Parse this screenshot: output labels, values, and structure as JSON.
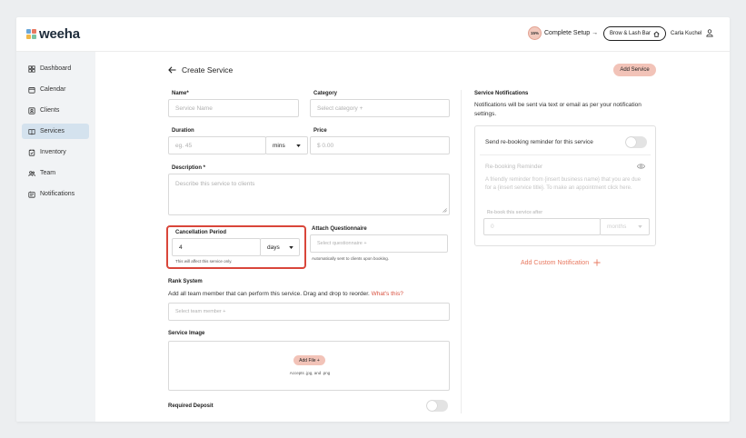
{
  "brand": {
    "name": "weeha",
    "mark_colors": [
      "#6aa7d8",
      "#e8785f",
      "#f0b84a",
      "#7cc4a2"
    ],
    "accent": "#f2c3b8",
    "highlight_border": "#d9463a",
    "link_color": "#d8503f"
  },
  "topbar": {
    "setup_percent": "15%",
    "setup_label": "Complete Setup →",
    "business_name": "Brow & Lash Bar",
    "user_name": "Carla Kuchel"
  },
  "sidebar": {
    "items": [
      {
        "label": "Dashboard",
        "icon": "dashboard-icon"
      },
      {
        "label": "Calendar",
        "icon": "calendar-icon"
      },
      {
        "label": "Clients",
        "icon": "clients-icon"
      },
      {
        "label": "Services",
        "icon": "services-icon",
        "active": true
      },
      {
        "label": "Inventory",
        "icon": "inventory-icon"
      },
      {
        "label": "Team",
        "icon": "team-icon"
      },
      {
        "label": "Notifications",
        "icon": "notifications-icon"
      }
    ]
  },
  "form": {
    "title": "Create Service",
    "add_button": "Add Service",
    "name_label": "Name",
    "name_placeholder": "Service Name",
    "category_label": "Category",
    "category_placeholder": "Select category +",
    "duration_label": "Duration",
    "duration_placeholder": "eg. 45",
    "duration_unit": "mins",
    "price_label": "Price",
    "price_placeholder": "$ 0.00",
    "description_label": "Description *",
    "description_placeholder": "Describe this service to clients",
    "cancellation_label": "Cancellation Period",
    "cancellation_value": "4",
    "cancellation_unit": "days",
    "cancellation_note": "This will affect this service only.",
    "questionnaire_label": "Attach Questionnaire",
    "questionnaire_placeholder": "Select questionnaire +",
    "questionnaire_note": "Automatically sent to clients upon booking.",
    "rank_label": "Rank System",
    "rank_desc": "Add all team member that can perform this service. Drag and drop to reorder.",
    "rank_link": "What's this?",
    "team_placeholder": "Select team member +",
    "image_label": "Service Image",
    "add_file": "Add File +",
    "accepts": "Accepts .jpg, and .png",
    "deposit_label": "Required Deposit"
  },
  "notifications": {
    "title": "Service Notifications",
    "desc": "Notifications will be sent via text or email as per your notification settings.",
    "rebooking_toggle": "Send re-booking reminder for this service",
    "reminder_label": "Re-booking Reminder",
    "reminder_text": "A friendly reminder from {insert business name} that you are due for a {insert service title}. To make an appointment click here.",
    "rebook_after_label": "Re-book this service after",
    "rebook_after_value": "0",
    "rebook_after_unit": "months",
    "add_custom": "Add Custom Notification"
  }
}
